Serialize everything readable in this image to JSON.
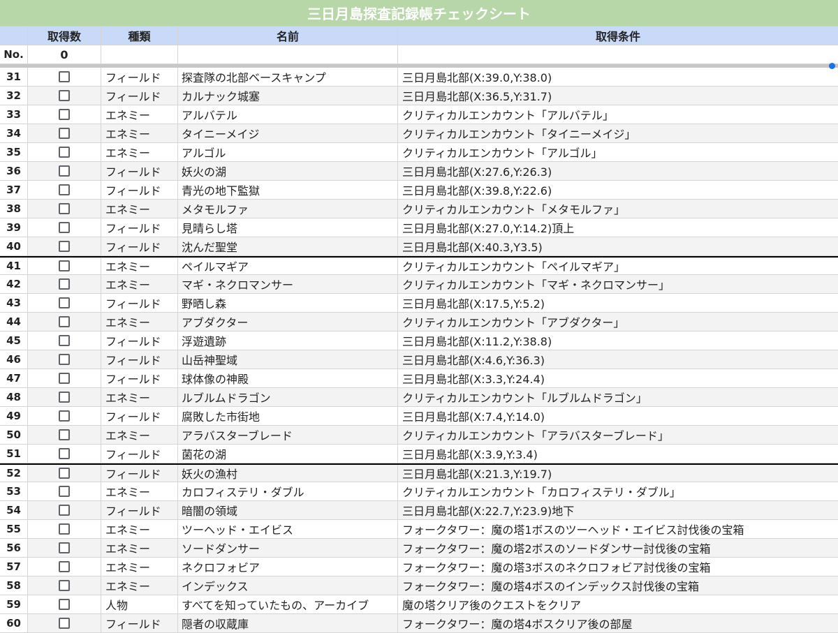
{
  "title": "三日月島探査記録帳チェックシート",
  "headers": {
    "col0": "",
    "acquired_count": "取得数",
    "type": "種類",
    "name": "名前",
    "condition": "取得条件"
  },
  "summary": {
    "no_label": "No.",
    "count": "0"
  },
  "rows": [
    {
      "no": "31",
      "type": "フィールド",
      "name": "探査隊の北部ベースキャンプ",
      "condition": "三日月島北部(X:39.0,Y:38.0)",
      "checked": false
    },
    {
      "no": "32",
      "type": "フィールド",
      "name": "カルナック城塞",
      "condition": "三日月島北部(X:36.5,Y:31.7)",
      "checked": false
    },
    {
      "no": "33",
      "type": "エネミー",
      "name": "アルバテル",
      "condition": "クリティカルエンカウント「アルバテル」",
      "checked": false
    },
    {
      "no": "34",
      "type": "エネミー",
      "name": "タイニーメイジ",
      "condition": "クリティカルエンカウント「タイニーメイジ」",
      "checked": false
    },
    {
      "no": "35",
      "type": "エネミー",
      "name": "アルゴル",
      "condition": "クリティカルエンカウント「アルゴル」",
      "checked": false
    },
    {
      "no": "36",
      "type": "フィールド",
      "name": "妖火の湖",
      "condition": "三日月島北部(X:27.6,Y:26.3)",
      "checked": false
    },
    {
      "no": "37",
      "type": "フィールド",
      "name": "青光の地下監獄",
      "condition": "三日月島北部(X:39.8,Y:22.6)",
      "checked": false
    },
    {
      "no": "38",
      "type": "エネミー",
      "name": "メタモルファ",
      "condition": "クリティカルエンカウント「メタモルファ」",
      "checked": false
    },
    {
      "no": "39",
      "type": "フィールド",
      "name": "見晴らし塔",
      "condition": "三日月島北部(X:27.0,Y:14.2)頂上",
      "checked": false
    },
    {
      "no": "40",
      "type": "フィールド",
      "name": "沈んだ聖堂",
      "condition": "三日月島北部(X:40.3,Y3.5)",
      "checked": false
    },
    {
      "no": "41",
      "type": "エネミー",
      "name": "ペイルマギア",
      "condition": "クリティカルエンカウント「ペイルマギア」",
      "checked": false
    },
    {
      "no": "42",
      "type": "エネミー",
      "name": "マギ・ネクロマンサー",
      "condition": "クリティカルエンカウント「マギ・ネクロマンサー」",
      "checked": false
    },
    {
      "no": "43",
      "type": "フィールド",
      "name": "野晒し森",
      "condition": "三日月島北部(X:17.5,Y:5.2)",
      "checked": false
    },
    {
      "no": "44",
      "type": "エネミー",
      "name": "アブダクター",
      "condition": "クリティカルエンカウント「アブダクター」",
      "checked": false
    },
    {
      "no": "45",
      "type": "フィールド",
      "name": "浮遊遺跡",
      "condition": "三日月島北部(X:11.2,Y:38.8)",
      "checked": false
    },
    {
      "no": "46",
      "type": "フィールド",
      "name": "山岳神聖域",
      "condition": "三日月島北部(X:4.6,Y:36.3)",
      "checked": false
    },
    {
      "no": "47",
      "type": "フィールド",
      "name": "球体像の神殿",
      "condition": "三日月島北部(X:3.3,Y:24.4)",
      "checked": false
    },
    {
      "no": "48",
      "type": "エネミー",
      "name": "ルブルムドラゴン",
      "condition": "クリティカルエンカウント「ルブルムドラゴン」",
      "checked": false
    },
    {
      "no": "49",
      "type": "フィールド",
      "name": "腐敗した市街地",
      "condition": "三日月島北部(X:7.4,Y:14.0)",
      "checked": false
    },
    {
      "no": "50",
      "type": "エネミー",
      "name": "アラバスターブレード",
      "condition": "クリティカルエンカウント「アラバスターブレード」",
      "checked": false
    },
    {
      "no": "51",
      "type": "フィールド",
      "name": "菌花の湖",
      "condition": "三日月島北部(X:3.9,Y:3.4)",
      "checked": false
    },
    {
      "no": "52",
      "type": "フィールド",
      "name": "妖火の漁村",
      "condition": "三日月島北部(X:21.3,Y:19.7)",
      "checked": false
    },
    {
      "no": "53",
      "type": "エネミー",
      "name": "カロフィステリ・ダブル",
      "condition": "クリティカルエンカウント「カロフィステリ・ダブル」",
      "checked": false
    },
    {
      "no": "54",
      "type": "フィールド",
      "name": "暗闇の領域",
      "condition": "三日月島北部(X:22.7,Y:23.9)地下",
      "checked": false
    },
    {
      "no": "55",
      "type": "エネミー",
      "name": "ツーヘッド・エイビス",
      "condition": "フォークタワー：魔の塔1ボスのツーヘッド・エイビス討伐後の宝箱",
      "checked": false
    },
    {
      "no": "56",
      "type": "エネミー",
      "name": "ソードダンサー",
      "condition": "フォークタワー：魔の塔2ボスのソードダンサー討伐後の宝箱",
      "checked": false
    },
    {
      "no": "57",
      "type": "エネミー",
      "name": "ネクロフォビア",
      "condition": "フォークタワー：魔の塔3ボスのネクロフォビア討伐後の宝箱",
      "checked": false
    },
    {
      "no": "58",
      "type": "エネミー",
      "name": "インデックス",
      "condition": "フォークタワー：魔の塔4ボスのインデックス討伐後の宝箱",
      "checked": false
    },
    {
      "no": "59",
      "type": "人物",
      "name": "すべてを知っていたもの、アーカイブ",
      "condition": "魔の塔クリア後のクエストをクリア",
      "checked": false
    },
    {
      "no": "60",
      "type": "フィールド",
      "name": "隠者の収蔵庫",
      "condition": "フォークタワー：魔の塔4ボスクリア後の部屋",
      "checked": false
    }
  ],
  "colors": {
    "title_bg": "#b7d7a8",
    "header_bg": "#c9daf8",
    "alt_row_bg": "#f3f3f3",
    "selection_dot": "#1a73e8"
  }
}
